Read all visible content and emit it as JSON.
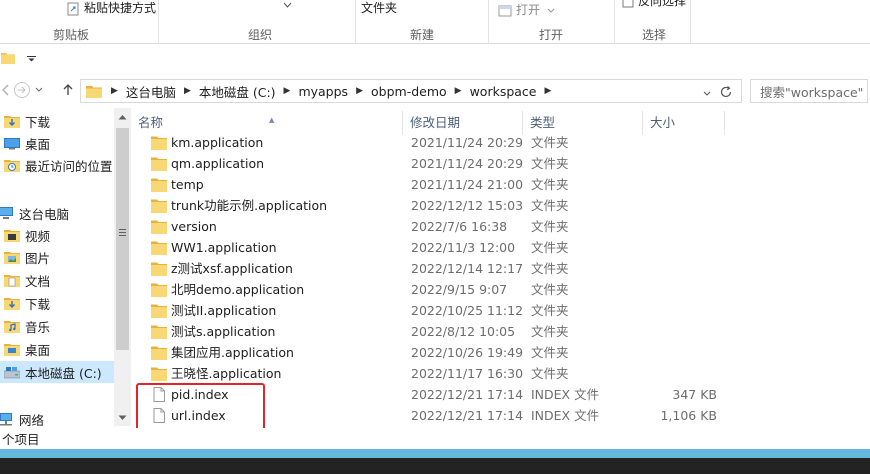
{
  "ribbon": {
    "paste_shortcut_label": "粘贴快捷方式",
    "folder_label": "文件夹",
    "open_label": "打开",
    "select_label": "反向选择",
    "groups": [
      "剪贴板",
      "组织",
      "新建",
      "打开",
      "选择"
    ]
  },
  "navigation": {
    "back_icon": "back-arrow-icon",
    "forward_icon": "forward-arrow-icon",
    "up_icon": "up-arrow-icon",
    "breadcrumbs": [
      "这台电脑",
      "本地磁盘 (C:)",
      "myapps",
      "obpm-demo",
      "workspace"
    ],
    "search_placeholder": "搜索\"workspace\""
  },
  "sidebar": {
    "items": [
      {
        "label": "下载",
        "icon": "download-folder-icon"
      },
      {
        "label": "桌面",
        "icon": "desktop-icon"
      },
      {
        "label": "最近访问的位置",
        "icon": "recent-places-icon"
      },
      {
        "label": "这台电脑",
        "icon": "computer-icon"
      },
      {
        "label": "视频",
        "icon": "video-folder-icon"
      },
      {
        "label": "图片",
        "icon": "picture-folder-icon"
      },
      {
        "label": "文档",
        "icon": "document-folder-icon"
      },
      {
        "label": "下载",
        "icon": "download-folder-icon"
      },
      {
        "label": "音乐",
        "icon": "music-folder-icon"
      },
      {
        "label": "桌面",
        "icon": "desktop-folder-icon"
      },
      {
        "label": "本地磁盘 (C:)",
        "icon": "drive-icon"
      },
      {
        "label": "网络",
        "icon": "network-icon"
      }
    ]
  },
  "columns": {
    "name": "名称",
    "date": "修改日期",
    "type": "类型",
    "size": "大小"
  },
  "files": [
    {
      "name": "km.application",
      "date": "2021/11/24 20:29",
      "type": "文件夹",
      "size": "",
      "kind": "folder"
    },
    {
      "name": "qm.application",
      "date": "2021/11/24 20:29",
      "type": "文件夹",
      "size": "",
      "kind": "folder"
    },
    {
      "name": "temp",
      "date": "2021/11/24 21:00",
      "type": "文件夹",
      "size": "",
      "kind": "folder"
    },
    {
      "name": "trunk功能示例.application",
      "date": "2022/12/12 15:03",
      "type": "文件夹",
      "size": "",
      "kind": "folder"
    },
    {
      "name": "version",
      "date": "2022/7/6 16:38",
      "type": "文件夹",
      "size": "",
      "kind": "folder"
    },
    {
      "name": "WW1.application",
      "date": "2022/11/3 12:00",
      "type": "文件夹",
      "size": "",
      "kind": "folder"
    },
    {
      "name": "z测试xsf.application",
      "date": "2022/12/14 12:17",
      "type": "文件夹",
      "size": "",
      "kind": "folder"
    },
    {
      "name": "北明demo.application",
      "date": "2022/9/15 9:07",
      "type": "文件夹",
      "size": "",
      "kind": "folder"
    },
    {
      "name": "测试II.application",
      "date": "2022/10/25 11:12",
      "type": "文件夹",
      "size": "",
      "kind": "folder"
    },
    {
      "name": "测试s.application",
      "date": "2022/8/12 10:05",
      "type": "文件夹",
      "size": "",
      "kind": "folder"
    },
    {
      "name": "集团应用.application",
      "date": "2022/10/26 19:49",
      "type": "文件夹",
      "size": "",
      "kind": "folder"
    },
    {
      "name": "王晓怪.application",
      "date": "2022/11/17 16:30",
      "type": "文件夹",
      "size": "",
      "kind": "folder"
    },
    {
      "name": "pid.index",
      "date": "2022/12/21 17:14",
      "type": "INDEX 文件",
      "size": "347 KB",
      "kind": "file"
    },
    {
      "name": "url.index",
      "date": "2022/12/21 17:14",
      "type": "INDEX 文件",
      "size": "1,106 KB",
      "kind": "file"
    }
  ],
  "status": {
    "count_text": "个项目"
  },
  "colors": {
    "folder": "#f4c550",
    "selection": "#cce8ff",
    "highlight_box": "#e0262b",
    "accent_bar": "#64b8de"
  }
}
